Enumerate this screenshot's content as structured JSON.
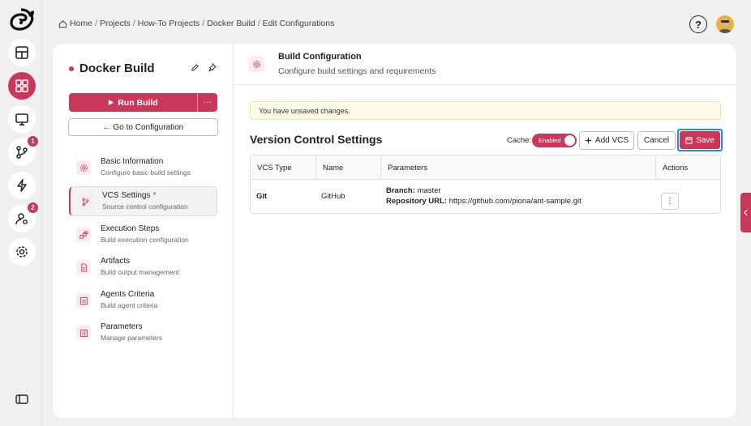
{
  "breadcrumb": [
    {
      "label": "Home"
    },
    {
      "label": "Projects"
    },
    {
      "label": "How-To Projects"
    },
    {
      "label": "Docker Build"
    },
    {
      "label": "Edit Configurations"
    }
  ],
  "help_label": "?",
  "rail": {
    "badges": {
      "vcs": "1",
      "users": "2"
    }
  },
  "build": {
    "title": "Docker Build",
    "run_label": "Run Build",
    "more_label": "···",
    "goto_label": "← Go to Configuration"
  },
  "nav": [
    {
      "title": "Basic Information",
      "sub": "Configure basic build settings"
    },
    {
      "title": "VCS Settings",
      "sub": "Source control configuration",
      "required": "*"
    },
    {
      "title": "Execution Steps",
      "sub": "Build execution configuration"
    },
    {
      "title": "Artifacts",
      "sub": "Build output management"
    },
    {
      "title": "Agents Criteria",
      "sub": "Build agent criteria"
    },
    {
      "title": "Parameters",
      "sub": "Manage parameters"
    }
  ],
  "config": {
    "title": "Build Configuration",
    "subtitle": "Configure build settings and requirements"
  },
  "alert": "You have unsaved changes.",
  "vcs": {
    "title": "Version Control Settings",
    "cache_label": "Cache:",
    "cache_state": "Enabled",
    "add_label": "Add VCS",
    "cancel_label": "Cancel",
    "save_label": "Save",
    "columns": [
      "VCS Type",
      "Name",
      "Parameters",
      "Actions"
    ],
    "rows": [
      {
        "type": "Git",
        "name": "GitHub",
        "branch_label": "Branch:",
        "branch": "master",
        "repo_label": "Repository URL:",
        "repo": "https://github.com/piona/ant-sample.git",
        "action": "⋮"
      }
    ]
  },
  "colors": {
    "accent": "#c9385a",
    "focus": "#1b8fe6",
    "alert_bg": "#fffbe6"
  }
}
